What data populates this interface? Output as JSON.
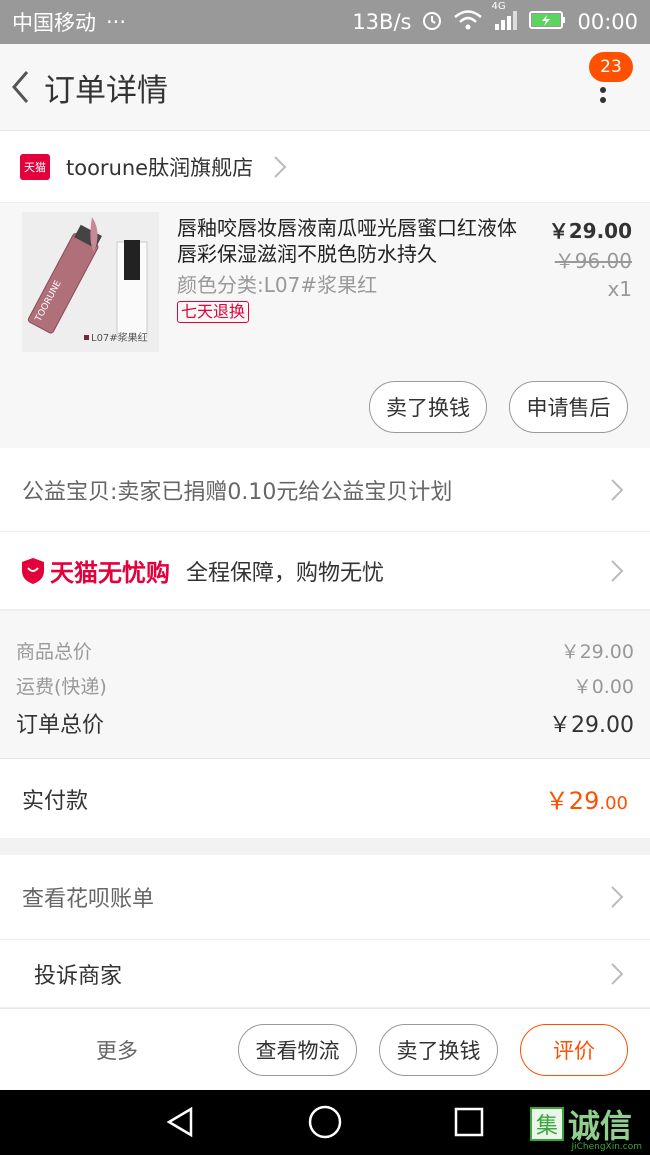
{
  "status_bar": {
    "carrier": "中国移动",
    "dots": "···",
    "speed": "13B/s",
    "net": "4G",
    "time": "00:00"
  },
  "header": {
    "title": "订单详情",
    "badge_count": "23"
  },
  "store": {
    "logo_text": "天猫",
    "name": "toorune肽润旗舰店"
  },
  "product": {
    "title": "唇釉咬唇妆唇液南瓜哑光唇蜜口红液体唇彩保湿滋润不脱色防水持久",
    "variant": "颜色分类:L07#浆果红",
    "return_tag": "七天退换",
    "price": "￥29.00",
    "original_price": "￥96.00",
    "quantity": "x1",
    "thumb_brand": "TOORUNE",
    "thumb_caption": "L07#浆果红",
    "buttons": {
      "sell": "卖了换钱",
      "after_sale": "申请售后"
    }
  },
  "charity": {
    "text": "公益宝贝:卖家已捐赠0.10元给公益宝贝计划"
  },
  "worry_free": {
    "logo_text": "天猫无忧购",
    "text": "全程保障，购物无忧"
  },
  "totals": {
    "goods_label": "商品总价",
    "goods_value": "￥29.00",
    "shipping_label": "运费(快递)",
    "shipping_value": "￥0.00",
    "order_label": "订单总价",
    "order_value": "￥29.00"
  },
  "paid": {
    "label": "实付款",
    "value_main": "￥29",
    "value_cents": ".00"
  },
  "links": {
    "huabei": "查看花呗账单",
    "complain": "投诉商家"
  },
  "bottom_bar": {
    "more": "更多",
    "logistics": "查看物流",
    "sell": "卖了换钱",
    "review": "评价"
  },
  "watermark": {
    "box_char": "集",
    "text": "诚信",
    "sub": "JiChengXin.com"
  },
  "colors": {
    "accent": "#ff5000",
    "tmall_red": "#e4003a"
  }
}
